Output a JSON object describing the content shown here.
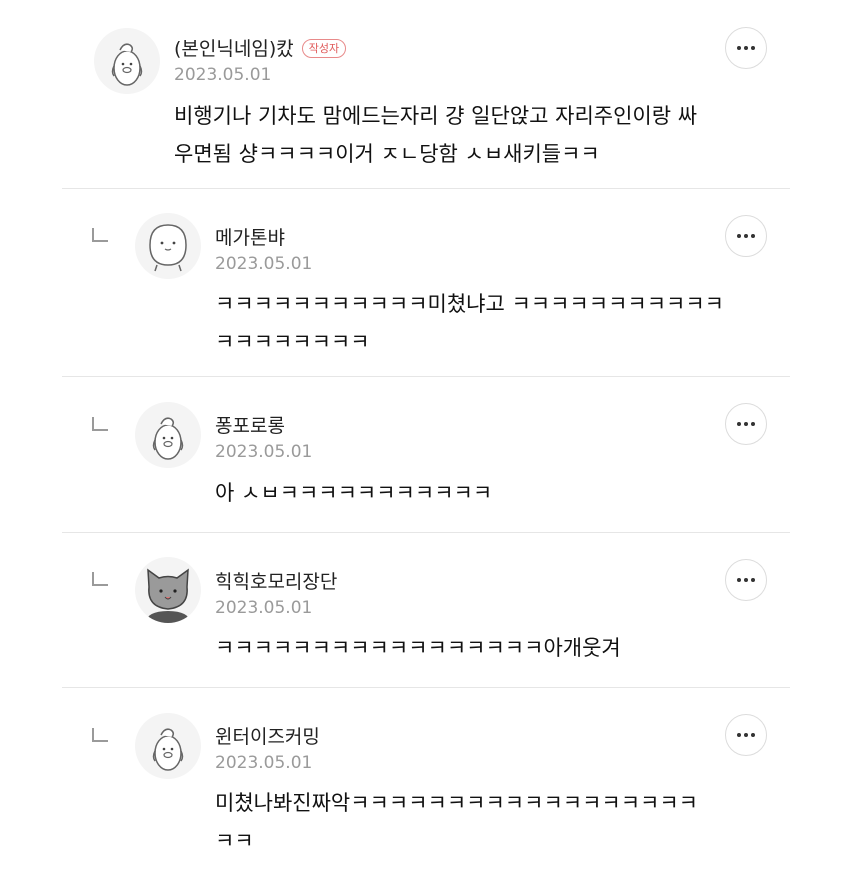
{
  "comments": [
    {
      "nickname": "(본인닉네임)캈",
      "badge": "작성자",
      "date": "2023.05.01",
      "lines": [
        "비행기나 기차도 맘에드는자리 걍 일단앉고 자리주인이랑 싸",
        "우면됨 샹ㅋㅋㅋㅋ이거 ㅈㄴ당함 ㅅㅂ새키들ㅋㅋ"
      ],
      "avatar": "penguin-avatar"
    },
    {
      "nickname": "메가톤뱌",
      "date": "2023.05.01",
      "lines": [
        "ㅋㅋㅋㅋㅋㅋㅋㅋㅋㅋㅋ미쳤냐고 ㅋㅋㅋㅋㅋㅋㅋㅋㅋㅋㅋ",
        "ㅋㅋㅋㅋㅋㅋㅋㅋ"
      ],
      "avatar": "blob-avatar"
    },
    {
      "nickname": "퐁포로롱",
      "date": "2023.05.01",
      "lines": [
        "아 ㅅㅂㅋㅋㅋㅋㅋㅋㅋㅋㅋㅋㅋ"
      ],
      "avatar": "penguin-avatar"
    },
    {
      "nickname": "힉힉호모리장단",
      "date": "2023.05.01",
      "lines": [
        "ㅋㅋㅋㅋㅋㅋㅋㅋㅋㅋㅋㅋㅋㅋㅋㅋㅋ아개웃겨"
      ],
      "avatar": "cat-avatar"
    },
    {
      "nickname": "윈터이즈커밍",
      "date": "2023.05.01",
      "lines": [
        "미쳤나봐진짜악ㅋㅋㅋㅋㅋㅋㅋㅋㅋㅋㅋㅋㅋㅋㅋㅋㅋㅋ",
        "ㅋㅋ"
      ],
      "avatar": "penguin-avatar"
    }
  ]
}
